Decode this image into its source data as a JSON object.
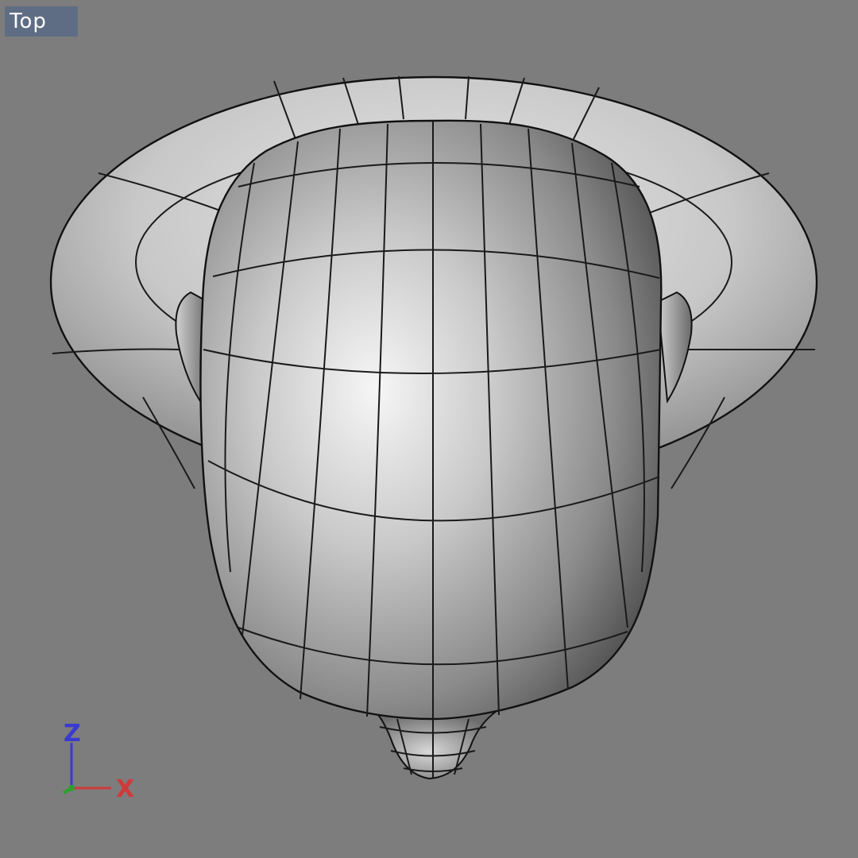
{
  "viewport": {
    "label": "Top",
    "background": "#7d7d7d",
    "label_background": "#5f6d84"
  },
  "axis_triad": {
    "z": {
      "label": "Z",
      "color": "#3a3ad0"
    },
    "x": {
      "label": "X",
      "color": "#d03a3a"
    },
    "y": {
      "color": "#2fa02f"
    }
  },
  "model": {
    "icons": [
      "head-mesh-icon",
      "hat-brim-icon",
      "nose-icon",
      "ear-icon"
    ]
  }
}
